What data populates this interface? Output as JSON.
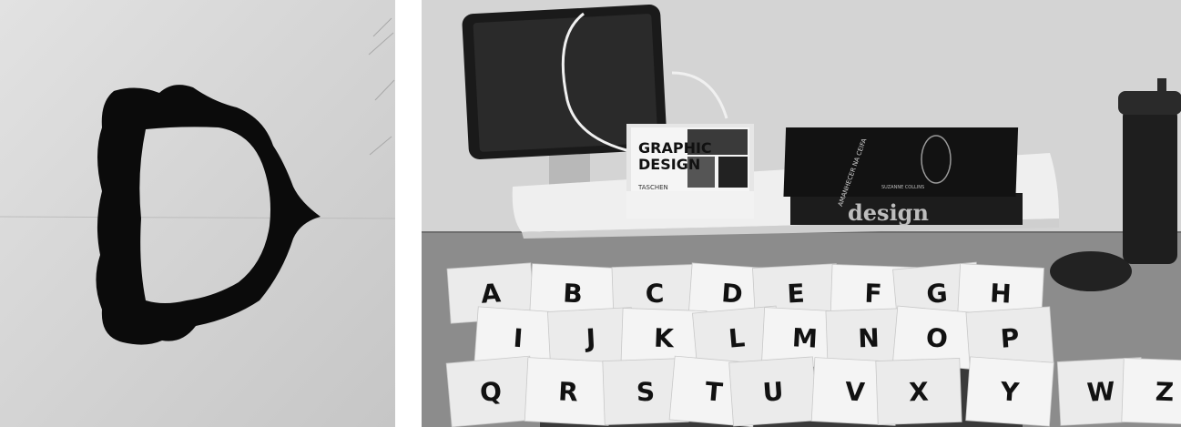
{
  "left_photo": {
    "letter": "D"
  },
  "right_photo": {
    "book_top": {
      "title_line1": "GRAPHIC",
      "title_line2": "DESIGN",
      "publisher": "TASCHEN"
    },
    "book_black_1": {
      "spine_title": "AMANHECER NA CEIFA",
      "author": "SUZANNE COLLINS"
    },
    "book_black_2": {
      "title": "design"
    },
    "letter_cards": [
      {
        "letter": "A"
      },
      {
        "letter": "B"
      },
      {
        "letter": "C"
      },
      {
        "letter": "D"
      },
      {
        "letter": "E"
      },
      {
        "letter": "F"
      },
      {
        "letter": "G"
      },
      {
        "letter": "H"
      },
      {
        "letter": "I"
      },
      {
        "letter": "J"
      },
      {
        "letter": "K"
      },
      {
        "letter": "L"
      },
      {
        "letter": "M"
      },
      {
        "letter": "N"
      },
      {
        "letter": "O"
      },
      {
        "letter": "P"
      },
      {
        "letter": "Q"
      },
      {
        "letter": "R"
      },
      {
        "letter": "S"
      },
      {
        "letter": "T"
      },
      {
        "letter": "U"
      },
      {
        "letter": "V"
      },
      {
        "letter": "X"
      },
      {
        "letter": "Y"
      },
      {
        "letter": "W"
      },
      {
        "letter": "Z"
      }
    ]
  }
}
